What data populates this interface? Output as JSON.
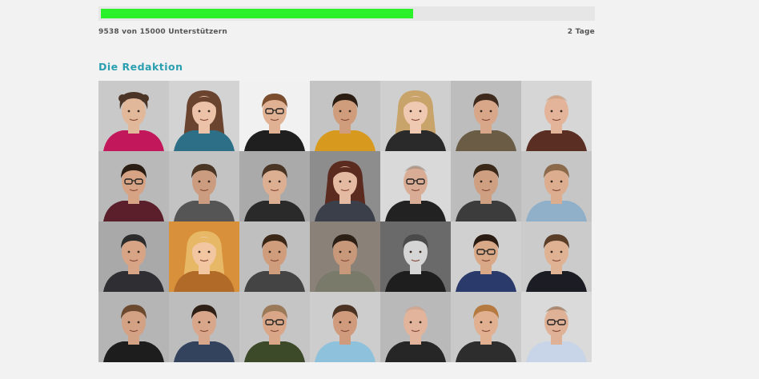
{
  "campaign": {
    "supporters_text": "9538 von 15000 Unterstützern",
    "days_left_text": "2 Tage",
    "supporters": 9538,
    "goal": 15000,
    "progress_color": "#2bf12b"
  },
  "team": {
    "title": "Die Redaktion",
    "title_color": "#2a9fb0",
    "portraits": [
      {
        "bg": "#c9c9c9",
        "skin": "#e2b89b",
        "hair": "#4a3426",
        "shirt": "#c2185b",
        "hairStyle": "curly"
      },
      {
        "bg": "#d3d3d3",
        "skin": "#ecc2a8",
        "hair": "#6b4430",
        "shirt": "#2c6f86",
        "hairStyle": "long"
      },
      {
        "bg": "#f1f1f1",
        "skin": "#e0b293",
        "hair": "#7a4e2e",
        "shirt": "#1f1f1f",
        "hairStyle": "short",
        "glasses": true
      },
      {
        "bg": "#c4c4c4",
        "skin": "#cf9d7c",
        "hair": "#2b1d12",
        "shirt": "#d79a1e",
        "hairStyle": "short"
      },
      {
        "bg": "#cfcfcf",
        "skin": "#f0c9b3",
        "hair": "#c9a46a",
        "shirt": "#2a2a2a",
        "hairStyle": "long"
      },
      {
        "bg": "#bdbdbd",
        "skin": "#d8a78a",
        "hair": "#3d2a1c",
        "shirt": "#6b5c46",
        "hairStyle": "short"
      },
      {
        "bg": "#d6d6d6",
        "skin": "#e3b49a",
        "hair": "#c49a7a",
        "shirt": "#5a2e22",
        "hairStyle": "bald"
      },
      {
        "bg": "#b9b9b9",
        "skin": "#d6a384",
        "hair": "#2a1d14",
        "shirt": "#5a1f2a",
        "hairStyle": "short",
        "glasses": true
      },
      {
        "bg": "#c3c3c3",
        "skin": "#cc9c80",
        "hair": "#4b3524",
        "shirt": "#555555",
        "hairStyle": "short"
      },
      {
        "bg": "#aaaaaa",
        "skin": "#dcae92",
        "hair": "#4a3424",
        "shirt": "#2a2a2a",
        "hairStyle": "short"
      },
      {
        "bg": "#8d8d8d",
        "skin": "#e5baa3",
        "hair": "#5c2b20",
        "shirt": "#3a3f4a",
        "hairStyle": "long"
      },
      {
        "bg": "#d9d9d9",
        "skin": "#d9ad95",
        "hair": "#9a8a80",
        "shirt": "#222222",
        "hairStyle": "bald",
        "glasses": true
      },
      {
        "bg": "#bcbcbc",
        "skin": "#cf9f82",
        "hair": "#3a2919",
        "shirt": "#3c3c3c",
        "hairStyle": "short"
      },
      {
        "bg": "#c6c6c6",
        "skin": "#dcad8e",
        "hair": "#8a6a4a",
        "shirt": "#8fb0c8",
        "hairStyle": "short"
      },
      {
        "bg": "#a9a9a9",
        "skin": "#d7a486",
        "hair": "#2c2c2c",
        "shirt": "#2f2f33",
        "hairStyle": "short"
      },
      {
        "bg": "#d8903a",
        "skin": "#f1c6a0",
        "hair": "#e7b866",
        "shirt": "#b26a28",
        "hairStyle": "long"
      },
      {
        "bg": "#bfbfbf",
        "skin": "#cf9c7c",
        "hair": "#3b2718",
        "shirt": "#444444",
        "hairStyle": "short"
      },
      {
        "bg": "#8a8278",
        "skin": "#c8987a",
        "hair": "#2b1f16",
        "shirt": "#7a7a6a",
        "hairStyle": "short"
      },
      {
        "bg": "#6a6a6a",
        "skin": "#d5d5d5",
        "hair": "#4a4a4a",
        "shirt": "#1e1e1e",
        "hairStyle": "short"
      },
      {
        "bg": "#d0d0d0",
        "skin": "#d8a887",
        "hair": "#2a1c12",
        "shirt": "#2a3a6a",
        "hairStyle": "short",
        "glasses": true
      },
      {
        "bg": "#cbcbcb",
        "skin": "#e0b294",
        "hair": "#5a3e28",
        "shirt": "#1c1c24",
        "hairStyle": "short"
      },
      {
        "bg": "#b5b5b5",
        "skin": "#d3a183",
        "hair": "#6b4a30",
        "shirt": "#1d1d1d",
        "hairStyle": "short"
      },
      {
        "bg": "#bdbdbd",
        "skin": "#d8a78b",
        "hair": "#2e2016",
        "shirt": "#33435e",
        "hairStyle": "short"
      },
      {
        "bg": "#c5c5c5",
        "skin": "#d9a688",
        "hair": "#9a7a58",
        "shirt": "#3d4a2a",
        "hairStyle": "short",
        "glasses": true
      },
      {
        "bg": "#cdcdcd",
        "skin": "#cf9b7c",
        "hair": "#4a3322",
        "shirt": "#8ec1dc",
        "hairStyle": "short"
      },
      {
        "bg": "#b9b9b9",
        "skin": "#e2b49c",
        "hair": "#caa08a",
        "shirt": "#262626",
        "hairStyle": "bald"
      },
      {
        "bg": "#c9c9c9",
        "skin": "#e0b090",
        "hair": "#b47a40",
        "shirt": "#2d2d2d",
        "hairStyle": "short"
      },
      {
        "bg": "#dadada",
        "skin": "#dfb196",
        "hair": "#8a6a52",
        "shirt": "#c8d4e8",
        "hairStyle": "bald",
        "glasses": true
      }
    ]
  }
}
